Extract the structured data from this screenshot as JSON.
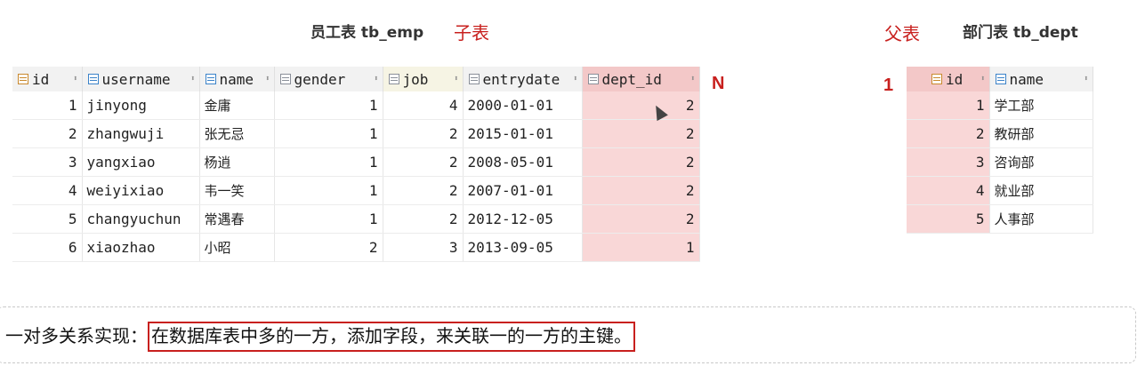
{
  "titles": {
    "emp": "员工表 tb_emp",
    "child": "子表",
    "parent": "父表",
    "dept": "部门表 tb_dept",
    "n": "N",
    "one": "1"
  },
  "emp_table": {
    "columns": [
      "id",
      "username",
      "name",
      "gender",
      "job",
      "entrydate",
      "dept_id"
    ],
    "rows": [
      [
        "1",
        "jinyong",
        "金庸",
        "1",
        "4",
        "2000-01-01",
        "2"
      ],
      [
        "2",
        "zhangwuji",
        "张无忌",
        "1",
        "2",
        "2015-01-01",
        "2"
      ],
      [
        "3",
        "yangxiao",
        "杨逍",
        "1",
        "2",
        "2008-05-01",
        "2"
      ],
      [
        "4",
        "weiyixiao",
        "韦一笑",
        "1",
        "2",
        "2007-01-01",
        "2"
      ],
      [
        "5",
        "changyuchun",
        "常遇春",
        "1",
        "2",
        "2012-12-05",
        "2"
      ],
      [
        "6",
        "xiaozhao",
        "小昭",
        "2",
        "3",
        "2013-09-05",
        "1"
      ]
    ]
  },
  "dept_table": {
    "columns": [
      "id",
      "name"
    ],
    "rows": [
      [
        "1",
        "学工部"
      ],
      [
        "2",
        "教研部"
      ],
      [
        "3",
        "咨询部"
      ],
      [
        "4",
        "就业部"
      ],
      [
        "5",
        "人事部"
      ]
    ]
  },
  "note": {
    "prefix": "一对多关系实现：",
    "highlight": "在数据库表中多的一方，添加字段，来关联一的一方的主键。"
  },
  "colors": {
    "accent_red": "#c8201e",
    "highlight_fill": "#f9d7d7"
  }
}
